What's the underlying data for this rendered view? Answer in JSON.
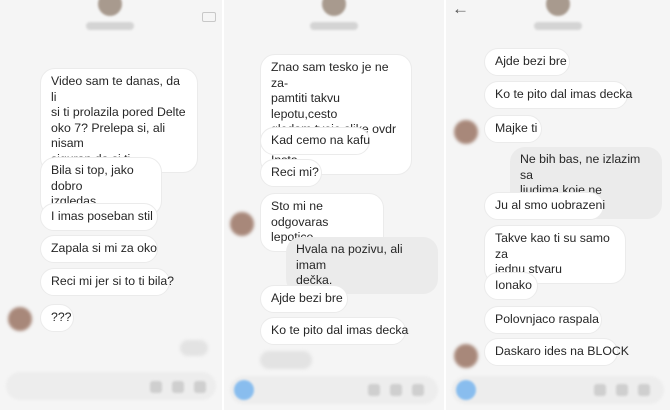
{
  "colors": {
    "panel_bg": "#f5f5f5",
    "incoming_bubble": "#ffffff",
    "outgoing_bubble": "#ebebeb",
    "camera_accent": "#3897f0"
  },
  "icons": {
    "back": "arrow-left-icon",
    "video_call": "video-call-icon",
    "camera": "camera-icon",
    "microphone": "microphone-icon",
    "gallery": "gallery-icon",
    "sticker": "sticker-icon"
  },
  "panel1": {
    "messages": [
      {
        "dir": "in",
        "text": "Video sam te danas, da li\nsi ti prolazila pored Delte\noko 7? Prelepa si, ali nisam\nsiguran da si ti"
      },
      {
        "dir": "in",
        "text": "Bila si top, jako dobro\nizgledas"
      },
      {
        "dir": "in",
        "text": "I imas poseban stil"
      },
      {
        "dir": "in",
        "text": "Zapala si mi za oko"
      },
      {
        "dir": "in",
        "text": "Reci mi jer si to ti bila?"
      },
      {
        "dir": "in",
        "text": "???"
      }
    ]
  },
  "panel2": {
    "messages": [
      {
        "dir": "in",
        "text": "Znao sam tesko je ne za-\npamtiti takvu lepotu,cesto\ngledam tvoje slike ovdr na\nInsta"
      },
      {
        "dir": "in",
        "text": "Kad cemo na kafu"
      },
      {
        "dir": "in",
        "text": "Reci mi?"
      },
      {
        "dir": "in",
        "text": "Sto mi ne odgovaras\nlepotice"
      },
      {
        "dir": "out",
        "text": "Hvala na pozivu, ali imam\ndečka."
      },
      {
        "dir": "in",
        "text": "Ajde bezi bre"
      },
      {
        "dir": "in",
        "text": "Ko te pito dal imas decka"
      }
    ]
  },
  "panel3": {
    "messages": [
      {
        "dir": "in",
        "text": "Ajde bezi bre"
      },
      {
        "dir": "in",
        "text": "Ko te pito dal imas decka"
      },
      {
        "dir": "in",
        "text": "Majke ti"
      },
      {
        "dir": "out",
        "text": "Ne bih bas, ne izlazim sa\nljudima koje ne poznajem"
      },
      {
        "dir": "in",
        "text": "Ju al smo uobrazeni"
      },
      {
        "dir": "in",
        "text": "Takve kao ti su samo za\njednu stvaru"
      },
      {
        "dir": "in",
        "text": "Ionako"
      },
      {
        "dir": "in",
        "text": "Polovnjaco raspala"
      },
      {
        "dir": "in",
        "text": "Daskaro ides na BLOCK"
      }
    ]
  }
}
